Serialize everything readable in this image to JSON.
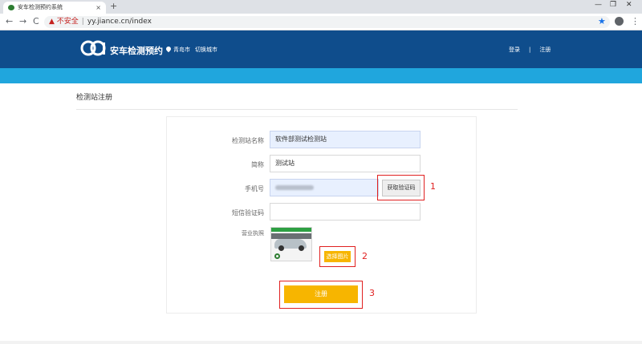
{
  "browser": {
    "tab_title": "安车检测预约系统",
    "tab_close": "×",
    "new_tab": "+",
    "win_min": "—",
    "win_max": "❐",
    "win_close": "✕",
    "back": "←",
    "forward": "→",
    "reload": "C",
    "security_label": "▲ 不安全",
    "security_sep": "|",
    "url": "yy.jiance.cn/index",
    "star": "★",
    "menu": "⋮"
  },
  "header": {
    "brand": "安车检测预约",
    "city": "青岛市",
    "switch_city": "切换城市",
    "login": "登录",
    "divider": "|",
    "register": "注册"
  },
  "page": {
    "title": "检测站注册"
  },
  "form": {
    "station_name_label": "检测站名称",
    "station_name_value": "软件部测试检测站",
    "short_name_label": "简称",
    "short_name_value": "测试站",
    "phone_label": "手机号",
    "get_code_button": "获取验证码",
    "sms_code_label": "短信验证码",
    "sms_code_value": "",
    "license_label": "营业执照",
    "choose_image_button": "选择图片",
    "submit_button": "注册"
  },
  "annotations": {
    "one": "1",
    "two": "2",
    "three": "3"
  },
  "colors": {
    "header_blue": "#0f4d8c",
    "band_blue": "#20a6dd",
    "accent_yellow": "#f7b500",
    "annotation_red": "#e02020"
  }
}
